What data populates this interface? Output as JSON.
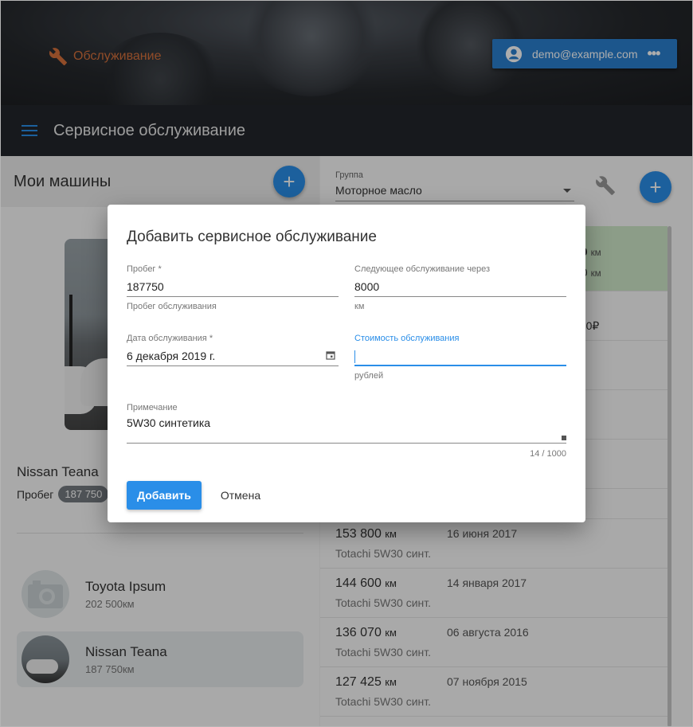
{
  "header": {
    "brand": "Обслуживание",
    "user_email": "demo@example.com",
    "user_more": "•••",
    "toolbar_title": "Сервисное обслуживание"
  },
  "left": {
    "title": "Мои машины",
    "add_symbol": "+",
    "selected_car": {
      "name": "Nissan Teana",
      "mileage_label": "Пробег",
      "mileage_value": "187 750"
    },
    "cars": [
      {
        "name": "Toyota Ipsum",
        "mileage": "202 500км"
      },
      {
        "name": "Nissan Teana",
        "mileage": "187 750км"
      }
    ]
  },
  "right": {
    "group_label": "Группа",
    "group_value": "Моторное масло",
    "add_symbol": "+",
    "peek": {
      "line1_value": "00",
      "line1_unit": "км",
      "line2_value": "00",
      "line2_unit": "км",
      "cost": "750₽"
    },
    "records": [
      {
        "km": "153 800",
        "unit": "км",
        "date": "16 июня 2017",
        "oil": "Totachi 5W30 синт."
      },
      {
        "km": "144 600",
        "unit": "км",
        "date": "14 января 2017",
        "oil": "Totachi 5W30 синт."
      },
      {
        "km": "136 070",
        "unit": "км",
        "date": "06 августа 2016",
        "oil": "Totachi 5W30 синт."
      },
      {
        "km": "127 425",
        "unit": "км",
        "date": "07 ноября 2015",
        "oil": "Totachi 5W30 синт."
      }
    ]
  },
  "dialog": {
    "title": "Добавить сервисное обслуживание",
    "mileage": {
      "label": "Пробег *",
      "value": "187750",
      "hint": "Пробег обслуживания"
    },
    "next_service": {
      "label": "Следующее обслуживание через",
      "value": "8000",
      "hint": "км"
    },
    "date": {
      "label": "Дата обслуживания *",
      "value": "6 декабря 2019 г."
    },
    "cost": {
      "label": "Стоимость обслуживания",
      "value": "",
      "hint": "рублей"
    },
    "note": {
      "label": "Примечание",
      "value": "5W30 синтетика",
      "counter": "14 / 1000"
    },
    "add_button": "Добавить",
    "cancel_button": "Отмена"
  },
  "colors": {
    "accent": "#2a8ee8",
    "brand": "#d6713c",
    "toolbar": "#22262b"
  }
}
